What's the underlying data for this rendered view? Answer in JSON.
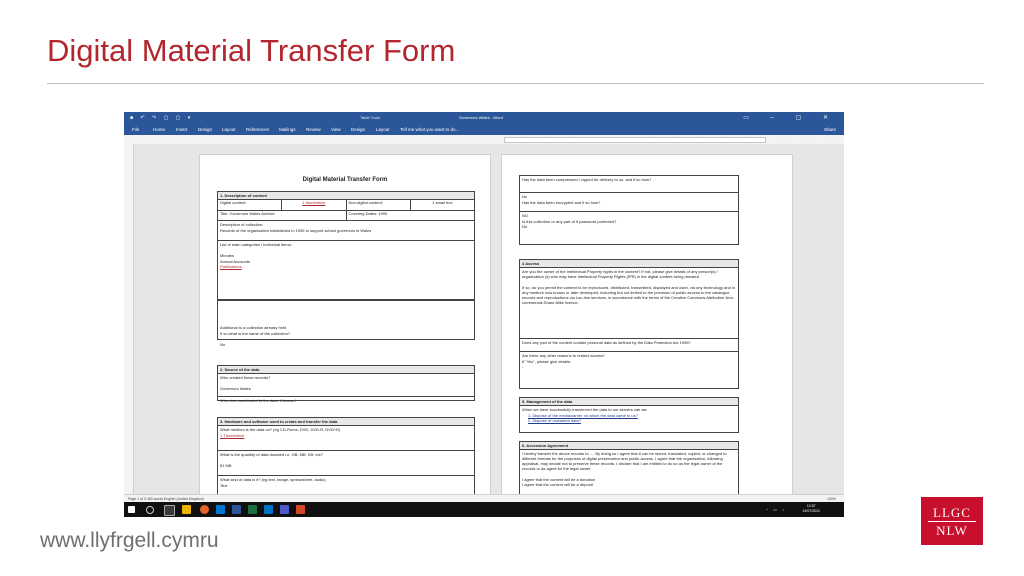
{
  "slide": {
    "title": "Digital Material Transfer Form",
    "footer_url": "www.llyfrgell.cymru",
    "logo_lines": [
      "LLGC",
      "NLW"
    ]
  },
  "word": {
    "doc_title": "Governors Wales - Word",
    "table_tools": "Table Tools",
    "ribbon_tabs": [
      "File",
      "Home",
      "Insert",
      "Design",
      "Layout",
      "References",
      "Mailings",
      "Review",
      "View",
      "Design",
      "Layout"
    ],
    "tell_me": "Tell me what you want to do...",
    "share_label": "Share",
    "status_left": "Page 1 of 3    460 words    English (United Kingdom)",
    "zoom": "100%",
    "clock_time": "12:57",
    "clock_date": "14/07/2021"
  },
  "page1": {
    "heading": "Digital Material Transfer Form",
    "sec1_head": "1. Description of content",
    "digital_content_label": "Digital content:",
    "digital_content_value": "1 thumbdrive",
    "nondigital_label": "Non-digital content:",
    "nondigital_value": "1 small box",
    "title_label": "Title: Governors Wales Archive",
    "covering_dates": "Covering Dates: 1995",
    "description_label": "Description of collection:",
    "description_value": "Records of the organisation established in 1995 to support school governors in Wales",
    "categories_label": "List of main categories / individual items:",
    "categories": [
      "Minutes",
      "Annual Accounts",
      "Publications"
    ],
    "additional_q1": "Additional to a collection already held",
    "additional_q2": "If so what is the name of the collection?",
    "additional_answer": "No",
    "sec2_head": "2. Source of the data",
    "who_created": "Who created these records?",
    "who_created_answer": "Governors Wales",
    "who_else": "Who else contributed to the data, if known?",
    "sec3_head": "3. Hardware and software used to create and transfer the data",
    "medium_q": "What medium is the data on? (eg CD-Roms, DVD, DVD-R, DVD+R)",
    "medium_answer": "1 Thumbdrive",
    "quantity_q": "What is the quantity of data donated i.e. GB; MB; KB; etc?",
    "quantity_answer": "81 MB",
    "kind_q": "What kind of data is it? (eg text, image, spreadsheet, audio)",
    "kind_answer": "Text"
  },
  "page2": {
    "compressed_q": "Has the data been compressed / zipped for delivery to us, and if so how?",
    "compressed_a": "No",
    "encrypted_q": "Has the data been encrypted and if so how?",
    "encrypted_a": "NO",
    "password_q": "Is this collection or any part of it password protected?",
    "password_a": "No",
    "sec4_head": "4 Access",
    "ipr_q": "Are you the owner of the Intellectual Property rights in the content? If not, please give details of any person(s) / organization (s) who may have Intellectual Property Rights (IPR) in the digital content being donated",
    "permit_q": "If so, do you permit the content to be reproduced, distributed, transmitted, displayed and used, via any technology and in any medium now known or later developed, including but not limited to the provision of public access to the catalogue records and reproductions via Lon-line services, in accordance with the terms of the Creative Commons Attribution-Non-commercial-Share Alike licence.",
    "personal_q": "Does any part of the content contain personal data as defined by the Data Protection Act 1998?",
    "other_q1": "Are there any other reasons to restrict access?",
    "other_q2": "If \"Yes\", please give details:",
    "other_a": "-",
    "sec5_head": "5. Management of the data",
    "mgmt_q": "When we have successfully transferred the data to our servers can we:",
    "mgmt_opt1": "1.  Dispose of the media/carrier on which the data came to us?",
    "mgmt_opt2": "2.  Dispose of unwanted data?",
    "sec6_head": "6. Accession Agreement",
    "agreement": "I hereby transfer the above records to .... By doing so I agree that it can be stored, translated, copied, or changed to different formats for the purposes of digital preservation and public access.   I agree that the organisation, following appraisal, may decide not to preserve these records.  I declare that I am entitled to do so as the legal owner of the records or as agent for the legal owner.",
    "donation": "I agree that the content will be a donation",
    "deposit": "I agree that the content will be a deposit"
  }
}
